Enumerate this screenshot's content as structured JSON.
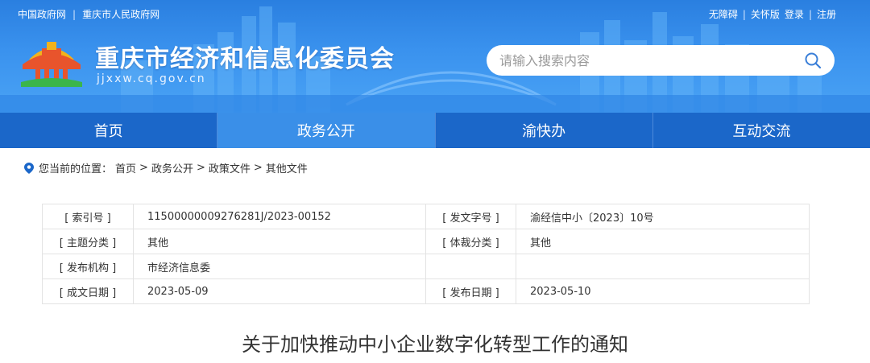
{
  "topbar": {
    "left_links": [
      "中国政府网",
      "重庆市人民政府网"
    ],
    "right_links": [
      "无障碍",
      "关怀版",
      "登录",
      "注册"
    ]
  },
  "site": {
    "title": "重庆市经济和信息化委员会",
    "domain": "jjxxw.cq.gov.cn"
  },
  "search": {
    "placeholder": "请输入搜索内容"
  },
  "nav": {
    "items": [
      {
        "label": "首页"
      },
      {
        "label": "政务公开"
      },
      {
        "label": "渝快办"
      },
      {
        "label": "互动交流"
      }
    ],
    "active_index": 1
  },
  "breadcrumb": {
    "prefix": "您当前的位置：",
    "items": [
      "首页",
      "政务公开",
      "政策文件",
      "其他文件"
    ],
    "separator": ">"
  },
  "info": {
    "rows": [
      {
        "k1": "[ 索引号 ]",
        "v1": "11500000009276281J/2023-00152",
        "k2": "[ 发文字号 ]",
        "v2": "渝经信中小〔2023〕10号"
      },
      {
        "k1": "[ 主题分类 ]",
        "v1": "其他",
        "k2": "[ 体裁分类 ]",
        "v2": "其他"
      },
      {
        "k1": "[ 发布机构 ]",
        "v1": "市经济信息委",
        "k2": "",
        "v2": ""
      },
      {
        "k1": "[ 成文日期 ]",
        "v1": "2023-05-09",
        "k2": "[ 发布日期 ]",
        "v2": "2023-05-10"
      }
    ]
  },
  "document": {
    "title": "关于加快推动中小企业数字化转型工作的通知"
  },
  "colors": {
    "header": "#3a92ee",
    "nav": "#1b67c9",
    "nav_active": "#3a8fe8"
  }
}
